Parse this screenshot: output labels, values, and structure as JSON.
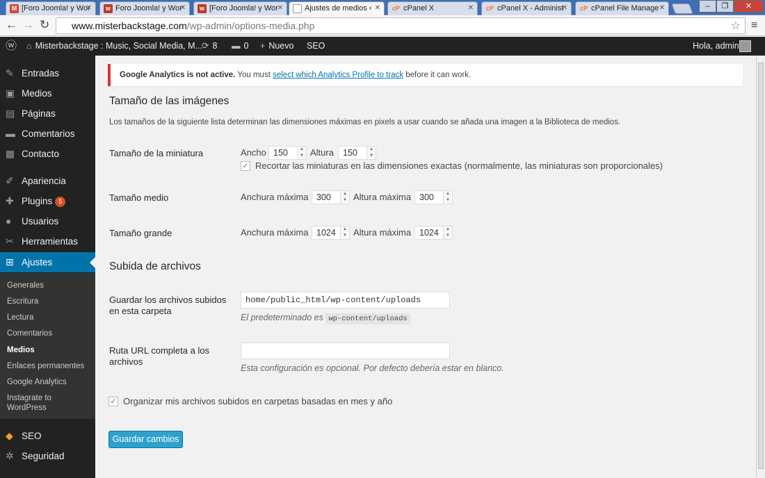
{
  "browser": {
    "tabs": [
      {
        "icon": "gmail-icon",
        "icon_char": "M",
        "color": "#d14836",
        "label": "[Foro Joomla! y Wor"
      },
      {
        "icon": "joomla-icon",
        "icon_char": "w",
        "color": "#c0392b",
        "label": "Foro Joomla! y Wor"
      },
      {
        "icon": "joomla-icon",
        "icon_char": "w",
        "color": "#c0392b",
        "label": "[Foro Joomla! y Wor"
      },
      {
        "icon": "page-icon",
        "icon_char": "",
        "color": "#ffffff",
        "label": "Ajustes de medios ‹"
      },
      {
        "icon": "cpanel-icon",
        "icon_char": "cP",
        "color": "#ff6c2c",
        "label": "cPanel X"
      },
      {
        "icon": "cpanel-icon",
        "icon_char": "cP",
        "color": "#ff6c2c",
        "label": "cPanel X - Administ"
      },
      {
        "icon": "cpanel-icon",
        "icon_char": "cP",
        "color": "#ff6c2c",
        "label": "cPanel File Manage"
      }
    ],
    "url_domain": "www.misterbackstage.com",
    "url_path": "/wp-admin/options-media.php"
  },
  "adminbar": {
    "site_name": "Misterbackstage : Music, Social Media, M...",
    "updates_count": "8",
    "comments_count": "0",
    "new_label": "Nuevo",
    "seo_label": "SEO",
    "greeting": "Hola, admin"
  },
  "sidebar": {
    "items": [
      {
        "icon": "pin-icon",
        "glyph": "✎",
        "label": "Entradas"
      },
      {
        "icon": "media-icon",
        "glyph": "▣",
        "label": "Medios"
      },
      {
        "icon": "pages-icon",
        "glyph": "▤",
        "label": "Páginas"
      },
      {
        "icon": "comments-icon",
        "glyph": "▬",
        "label": "Comentarios"
      },
      {
        "icon": "contact-icon",
        "glyph": "▦",
        "label": "Contacto"
      },
      {
        "icon": "appearance-icon",
        "glyph": "✐",
        "label": "Apariencia"
      },
      {
        "icon": "plugins-icon",
        "glyph": "✚",
        "label": "Plugins",
        "badge": "5"
      },
      {
        "icon": "users-icon",
        "glyph": "●",
        "label": "Usuarios"
      },
      {
        "icon": "tools-icon",
        "glyph": "✂",
        "label": "Herramientas"
      },
      {
        "icon": "settings-icon",
        "glyph": "⊞",
        "label": "Ajustes"
      },
      {
        "icon": "seo-icon",
        "glyph": "◆",
        "label": "SEO"
      },
      {
        "icon": "security-icon",
        "glyph": "✲",
        "label": "Seguridad"
      }
    ],
    "submenu": [
      "Generales",
      "Escritura",
      "Lectura",
      "Comentarios",
      "Medios",
      "Enlaces permanentes",
      "Google Analytics",
      "Instagrate to WordPress"
    ]
  },
  "notice": {
    "bold": "Google Analytics is not active.",
    "text": "You must",
    "link": "select which Analytics Profile to track",
    "after": "before it can work."
  },
  "images": {
    "heading": "Tamaño de las imágenes",
    "description": "Los tamaños de la siguiente lista determinan las dimensiones máximas en pixels a usar cuando se añada una imagen a la Biblioteca de medios.",
    "thumb_label": "Tamaño de la miniatura",
    "thumb_w_label": "Ancho",
    "thumb_w": "150",
    "thumb_h_label": "Altura",
    "thumb_h": "150",
    "crop_label": "Recortar las miniaturas en las dimensiones exactas (normalmente, las miniaturas son proporcionales)",
    "medium_label": "Tamaño medio",
    "max_w_label": "Anchura máxima",
    "max_h_label": "Altura máxima",
    "medium_w": "300",
    "medium_h": "300",
    "large_label": "Tamaño grande",
    "large_w": "1024",
    "large_h": "1024"
  },
  "uploads": {
    "heading": "Subida de archivos",
    "folder_label": "Guardar los archivos subidos en esta carpeta",
    "folder_value": "home/public_html/wp-content/uploads",
    "folder_hint": "El predeterminado es",
    "folder_hint_code": "wp-content/uploads",
    "url_label": "Ruta URL completa a los archivos",
    "url_value": "",
    "url_hint": "Esta configuración es opcional. Por defecto debería estar en blanco.",
    "organize_label": "Organizar mis archivos subidos en carpetas basadas en mes y año"
  },
  "save_button": "Guardar cambios"
}
